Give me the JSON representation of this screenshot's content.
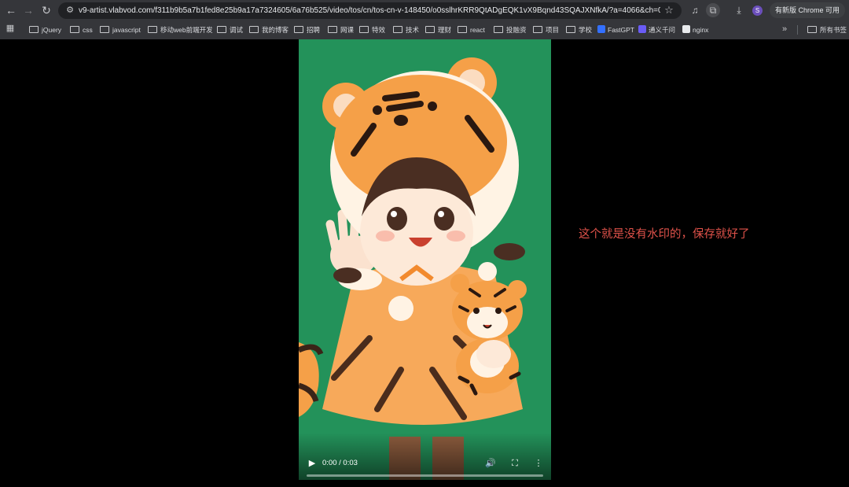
{
  "browser": {
    "url": "v9-artist.vlabvod.com/f311b9b5a7b1fed8e25b9a17a7324605/6a76b525/video/tos/cn/tos-cn-v-148450/o0sslhrKRR9QtADgEQK1vX9Bqnd43SQAJXNfkA/?a=4066&ch=0&cr...",
    "profile_initial": "S",
    "update_label": "有新版 Chrome 可用",
    "more_bookmarks": "»",
    "all_bookmarks_label": "所有书签",
    "bookmarks": [
      {
        "label": "jQuery",
        "type": "folder"
      },
      {
        "label": "css",
        "type": "folder"
      },
      {
        "label": "javascript",
        "type": "folder"
      },
      {
        "label": "移动web前端开发",
        "type": "folder"
      },
      {
        "label": "调试",
        "type": "folder"
      },
      {
        "label": "我的博客",
        "type": "folder"
      },
      {
        "label": "招聘",
        "type": "folder"
      },
      {
        "label": "网课",
        "type": "folder"
      },
      {
        "label": "特效",
        "type": "folder"
      },
      {
        "label": "技术",
        "type": "folder"
      },
      {
        "label": "理财",
        "type": "folder"
      },
      {
        "label": "react",
        "type": "folder"
      },
      {
        "label": "投融资",
        "type": "folder"
      },
      {
        "label": "项目",
        "type": "folder"
      },
      {
        "label": "学校",
        "type": "folder"
      },
      {
        "label": "FastGPT",
        "type": "site",
        "color": "#3370ff"
      },
      {
        "label": "通义千问",
        "type": "site",
        "color": "#6a5cf6"
      },
      {
        "label": "nginx",
        "type": "site",
        "color": "#e8eaed"
      }
    ]
  },
  "video": {
    "current_time": "0:00",
    "duration": "0:03",
    "time_text": "0:00 / 0:03",
    "progress": 0,
    "background_color": "#23925a"
  },
  "caption": "这个就是没有水印的，保存就好了",
  "colors": {
    "caption": "#e0524a",
    "chrome_bar": "#35363a",
    "tiger_orange": "#f5a048"
  }
}
